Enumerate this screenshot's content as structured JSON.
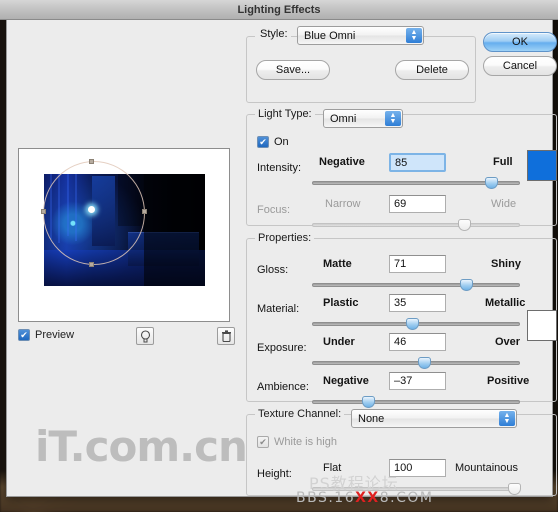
{
  "window": {
    "title": "Lighting Effects"
  },
  "preview": {
    "checkbox_label": "Preview",
    "checked": true,
    "add_light_icon": "light-bulb-icon",
    "delete_light_icon": "trash-icon"
  },
  "style_group": {
    "legend": "",
    "style_label": "Style:",
    "style_value": "Blue Omni",
    "save_label": "Save...",
    "delete_label": "Delete"
  },
  "actions": {
    "ok_label": "OK",
    "cancel_label": "Cancel"
  },
  "light_type_group": {
    "legend": "Light Type:",
    "light_type_value": "Omni",
    "on_label": "On",
    "on_checked": true,
    "intensity": {
      "label": "Intensity:",
      "min_label": "Negative",
      "max_label": "Full",
      "value": "85",
      "percent": 86
    },
    "focus": {
      "label": "Focus:",
      "min_label": "Narrow",
      "max_label": "Wide",
      "value": "69",
      "percent": 73,
      "disabled": true
    },
    "light_color_hex": "#0f6fdb"
  },
  "properties_group": {
    "legend": "Properties:",
    "gloss": {
      "label": "Gloss:",
      "min_label": "Matte",
      "max_label": "Shiny",
      "value": "71",
      "percent": 74
    },
    "material": {
      "label": "Material:",
      "min_label": "Plastic",
      "max_label": "Metallic",
      "value": "35",
      "percent": 48
    },
    "exposure": {
      "label": "Exposure:",
      "min_label": "Under",
      "max_label": "Over",
      "value": "46",
      "percent": 54
    },
    "ambience": {
      "label": "Ambience:",
      "min_label": "Negative",
      "max_label": "Positive",
      "value": "–37",
      "percent": 27
    },
    "material_color_hex": "#ffffff"
  },
  "texture_group": {
    "legend": "Texture Channel:",
    "channel_value": "None",
    "white_is_high_label": "White is high",
    "white_is_high_checked": true,
    "white_is_high_disabled": true,
    "height": {
      "label": "Height:",
      "min_label": "Flat",
      "max_label": "Mountainous",
      "value": "100",
      "percent": 97,
      "disabled": true
    }
  },
  "watermarks": {
    "left": "iT.com.cn",
    "bottom_right_1": "PS教程论坛",
    "bottom_right_2_pre": "BBS.16",
    "bottom_right_2_red": "XX",
    "bottom_right_2_post": "8.COM"
  }
}
